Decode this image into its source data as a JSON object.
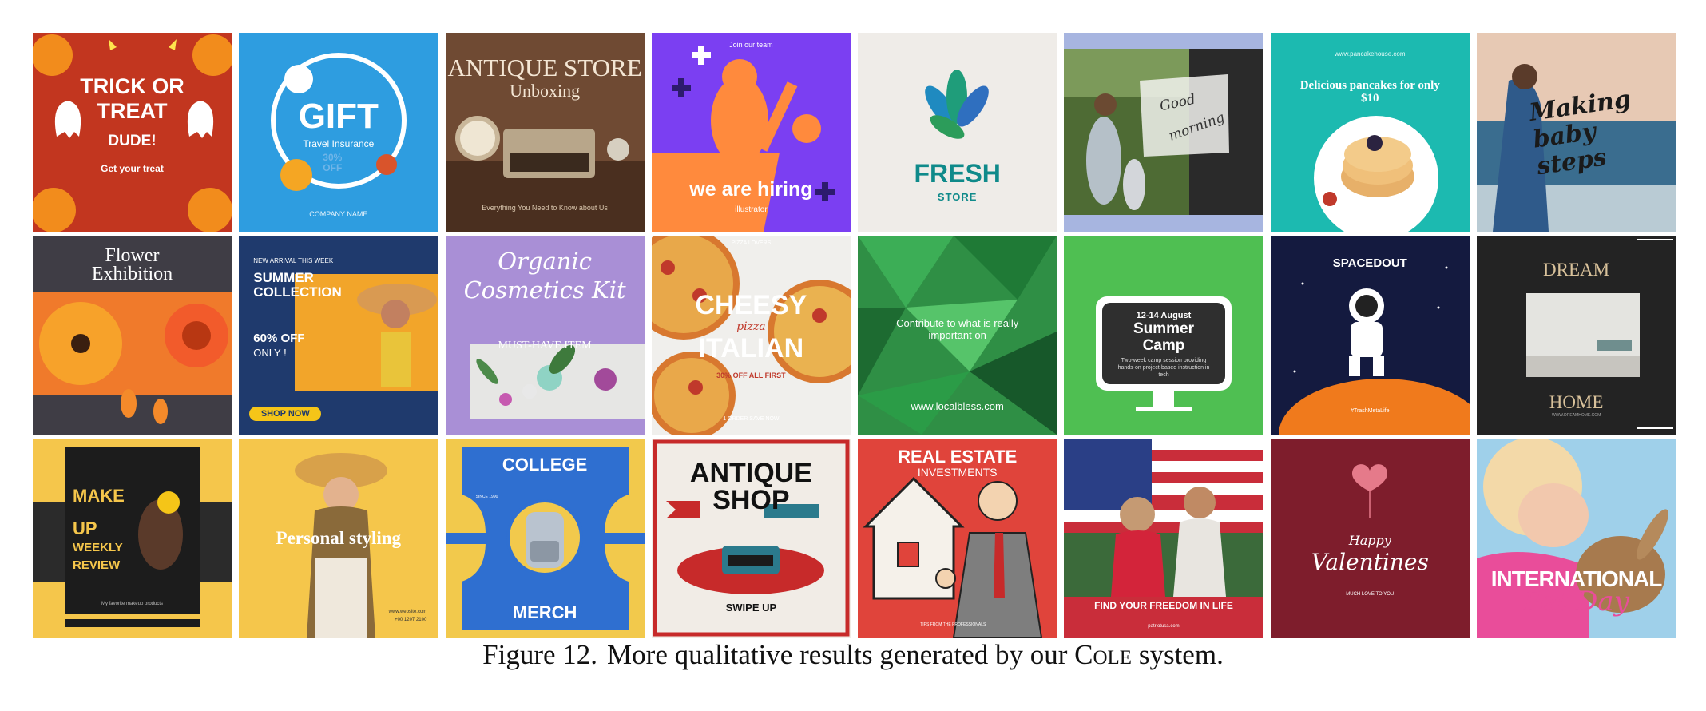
{
  "figure": {
    "label": "Figure 12.",
    "caption_before": "More qualitative results generated by our ",
    "caption_system": "Cole",
    "caption_after": " system."
  },
  "tiles": {
    "t1": {
      "title": "TRICK OR TREAT",
      "line2": "DUDE!",
      "sub": "Get your treat"
    },
    "t2": {
      "title": "GIFT",
      "sub": "Travel Insurance",
      "offer": "30% OFF",
      "company": "COMPANY NAME"
    },
    "t3": {
      "title": "ANTIQUE STORE",
      "sub": "Unboxing",
      "foot": "Everything You Need to Know about Us"
    },
    "t4": {
      "top": "Join our team",
      "title": "we are hiring",
      "sub": "illustrator"
    },
    "t5": {
      "title": "FRESH",
      "sub": "STORE"
    },
    "t6": {
      "line1": "Good",
      "line2": "morning"
    },
    "t7": {
      "url": "www.pancakehouse.com",
      "title": "Delicious pancakes for only $10"
    },
    "t8": {
      "title": "Making baby steps"
    },
    "t9": {
      "title": "Flower Exhibition"
    },
    "t10": {
      "top": "NEW ARRIVAL THIS WEEK",
      "title": "SUMMER COLLECTION",
      "offer": "60% OFF",
      "sub": "ONLY !",
      "button": "SHOP NOW"
    },
    "t11": {
      "title": "Organic Cosmetics Kit",
      "sub": "MUST-HAVE ITEM"
    },
    "t12": {
      "top": "PIZZA LOVERS",
      "title": "CHEESY",
      "mid": "pizza",
      "title2": "ITALIAN",
      "offer": "30% OFF ALL FIRST",
      "foot": "1 ORDER SAVE NOW"
    },
    "t13": {
      "title": "Contribute to what is really important on",
      "url": "www.localbless.com"
    },
    "t14": {
      "date": "12-14 August",
      "title": "Summer Camp",
      "sub": "Two-week camp session providing hands-on project-based instruction in tech"
    },
    "t15": {
      "title": "SPACEDOUT",
      "tag": "#TrashMetaLife"
    },
    "t16": {
      "title": "DREAM",
      "sub": "HOME",
      "foot": "WWW.DREAMHOME.COM"
    },
    "t17": {
      "l1": "MAKE",
      "l2": "UP",
      "l3": "WEEKLY",
      "l4": "REVIEW",
      "foot": "My favorite makeup products"
    },
    "t18": {
      "title": "Personal styling",
      "foot": "www.website.com",
      "phone": "+00 1207 2100"
    },
    "t19": {
      "title": "COLLEGE",
      "date": "SINCE 1990",
      "sub": "MERCH"
    },
    "t20": {
      "title": "ANTIQUE SHOP",
      "sub": "SWIPE UP"
    },
    "t21": {
      "title": "REAL ESTATE",
      "sub": "INVESTMENTS",
      "foot": "TIPS FROM THE PROFESSIONALS"
    },
    "t22": {
      "title": "FIND YOUR FREEDOM IN LIFE",
      "url": "patriotusa.com"
    },
    "t23": {
      "l1": "Happy",
      "l2": "Valentines",
      "sub": "MUCH LOVE TO YOU"
    },
    "t24": {
      "title": "INTERNATIONAL",
      "sub": "Pet Day"
    }
  }
}
